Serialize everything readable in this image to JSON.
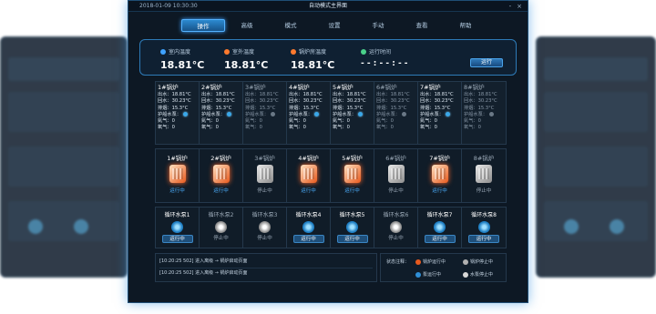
{
  "window": {
    "datetime": "2018-01-09  10:30:30",
    "title": "自动模式主界面",
    "ctrl_min": "-",
    "ctrl_close": "×"
  },
  "nav": [
    "操作",
    "高级",
    "模式",
    "设置",
    "手动",
    "查看",
    "帮助"
  ],
  "summary": {
    "indoor": {
      "label": "室内温度",
      "value": "18.81°C",
      "color": "#3fa2ff"
    },
    "outdoor": {
      "label": "室外温度",
      "value": "18.81°C",
      "color": "#ff7a2e"
    },
    "boiler_room": {
      "label": "锅炉房温度",
      "value": "18.81°C",
      "color": "#ff7a2e"
    },
    "runtime": {
      "label": "运行时间",
      "value": "- - : - - : - -",
      "color": "#4ad08a"
    },
    "run_button": "运行"
  },
  "boiler_info": [
    {
      "name": "1#锅炉",
      "out": "出水：18.81°C",
      "ret": "回水：30.23°C",
      "exh": "排烟：15.3°C",
      "pump": "护船水泵：",
      "n2": "氮气：0",
      "o2": "氧气：0",
      "on": true
    },
    {
      "name": "2#锅炉",
      "out": "出水：18.81°C",
      "ret": "回水：30.23°C",
      "exh": "排烟：15.3°C",
      "pump": "护船水泵：",
      "n2": "氮气：0",
      "o2": "氧气：0",
      "on": true
    },
    {
      "name": "3#锅炉",
      "out": "出水：18.81°C",
      "ret": "回水：30.23°C",
      "exh": "排烟：15.3°C",
      "pump": "护船水泵：",
      "n2": "氮气：0",
      "o2": "氧气：0",
      "on": false
    },
    {
      "name": "4#锅炉",
      "out": "出水：18.81°C",
      "ret": "回水：30.23°C",
      "exh": "排烟：15.3°C",
      "pump": "护船水泵：",
      "n2": "氮气：0",
      "o2": "氧气：0",
      "on": true
    },
    {
      "name": "5#锅炉",
      "out": "出水：18.81°C",
      "ret": "回水：30.23°C",
      "exh": "排烟：15.3°C",
      "pump": "护船水泵：",
      "n2": "氮气：0",
      "o2": "氧气：0",
      "on": true
    },
    {
      "name": "6#锅炉",
      "out": "出水：18.81°C",
      "ret": "回水：30.23°C",
      "exh": "排烟：15.3°C",
      "pump": "护船水泵：",
      "n2": "氮气：0",
      "o2": "氧气：0",
      "on": false
    },
    {
      "name": "7#锅炉",
      "out": "出水：18.81°C",
      "ret": "回水：30.23°C",
      "exh": "排烟：15.3°C",
      "pump": "护船水泵：",
      "n2": "氮气：0",
      "o2": "氧气：0",
      "on": true
    },
    {
      "name": "8#锅炉",
      "out": "出水：18.81°C",
      "ret": "回水：30.23°C",
      "exh": "排烟：15.3°C",
      "pump": "护船水泵：",
      "n2": "氮气：0",
      "o2": "氧气：0",
      "on": false
    }
  ],
  "boilers": [
    {
      "name": "1#锅炉",
      "status": "运行中",
      "on": true
    },
    {
      "name": "2#锅炉",
      "status": "运行中",
      "on": true
    },
    {
      "name": "3#锅炉",
      "status": "停止中",
      "on": false
    },
    {
      "name": "4#锅炉",
      "status": "运行中",
      "on": true
    },
    {
      "name": "5#锅炉",
      "status": "运行中",
      "on": true
    },
    {
      "name": "6#锅炉",
      "status": "停止中",
      "on": false
    },
    {
      "name": "7#锅炉",
      "status": "运行中",
      "on": true
    },
    {
      "name": "8#锅炉",
      "status": "停止中",
      "on": false
    }
  ],
  "pumps": [
    {
      "name": "循环水泵1",
      "status": "运行中",
      "on": true
    },
    {
      "name": "循环水泵2",
      "status": "停止中",
      "on": false
    },
    {
      "name": "循环水泵3",
      "status": "停止中",
      "on": false
    },
    {
      "name": "循环水泵4",
      "status": "运行中",
      "on": true
    },
    {
      "name": "循环水泵5",
      "status": "运行中",
      "on": true
    },
    {
      "name": "循环水泵6",
      "status": "停止中",
      "on": false
    },
    {
      "name": "循环水泵7",
      "status": "运行中",
      "on": true
    },
    {
      "name": "循环水泵8",
      "status": "运行中",
      "on": true
    }
  ],
  "log": [
    "[10:20:25  502]  进入离级 → 锅炉启动页面",
    "[10:20:25  502]  进入离级 → 锅炉启动页面"
  ],
  "legend": {
    "title": "状态注释：",
    "boiler_run": "锅炉运行中",
    "boiler_stop": "锅炉停止中",
    "pump_run": "泵运行中",
    "pump_stop": "水泵停止中",
    "colors": {
      "boiler_run": "#e85a1e",
      "boiler_stop": "#b0b0b0",
      "pump_run": "#2f8fd6",
      "pump_stop": "#d8d8d8"
    }
  }
}
